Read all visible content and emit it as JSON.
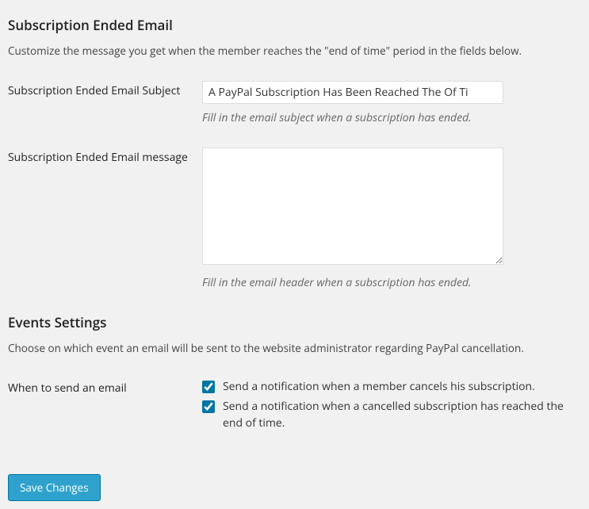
{
  "section1": {
    "heading": "Subscription Ended Email",
    "desc": "Customize the message you get when the member reaches the \"end of time\" period in the fields below."
  },
  "fields": {
    "subject": {
      "label": "Subscription Ended Email Subject",
      "value": "A PayPal Subscription Has Been Reached The Of Ti",
      "help": "Fill in the email subject when a subscription has ended."
    },
    "message": {
      "label": "Subscription Ended Email message",
      "value": "",
      "help": "Fill in the email header when a subscription has ended."
    }
  },
  "section2": {
    "heading": "Events Settings",
    "desc": "Choose on which event an email will be sent to the website administrator regarding PayPal cancellation."
  },
  "events": {
    "label": "When to send an email",
    "opt1": "Send a notification when a member cancels his subscription.",
    "opt2": "Send a notification when a cancelled subscription has reached the end of time."
  },
  "save_label": "Save Changes"
}
